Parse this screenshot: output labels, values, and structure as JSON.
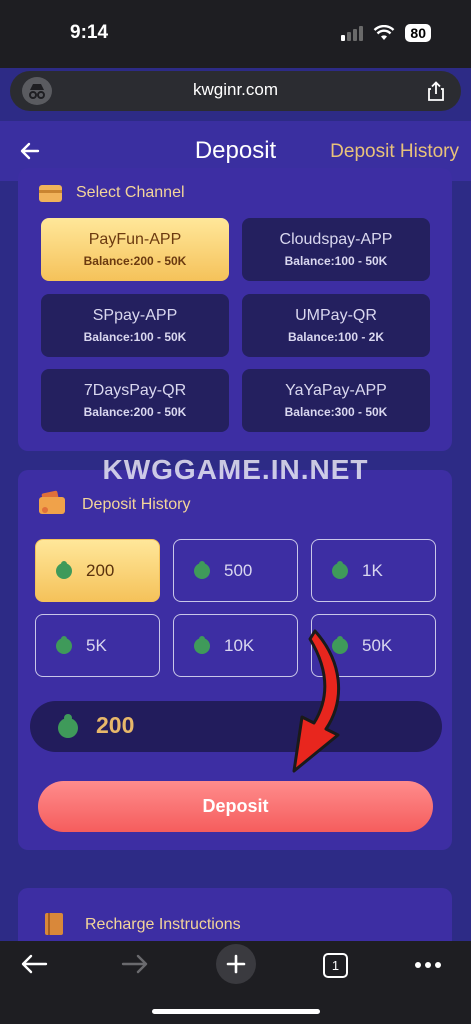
{
  "status": {
    "time": "9:14",
    "battery": "80"
  },
  "browser": {
    "url": "kwginr.com",
    "tab_count": "1"
  },
  "header": {
    "title": "Deposit",
    "history_link": "Deposit History"
  },
  "channel_section": {
    "title": "Select Channel",
    "channels": [
      {
        "name": "PayFun-APP",
        "balance": "Balance:200 - 50K"
      },
      {
        "name": "Cloudspay-APP",
        "balance": "Balance:100 - 50K"
      },
      {
        "name": "SPpay-APP",
        "balance": "Balance:100 - 50K"
      },
      {
        "name": "UMPay-QR",
        "balance": "Balance:100 - 2K"
      },
      {
        "name": "7DaysPay-QR",
        "balance": "Balance:200 - 50K"
      },
      {
        "name": "YaYaPay-APP",
        "balance": "Balance:300 - 50K"
      }
    ],
    "selected": "PayFun-APP"
  },
  "watermark": "KWGGAME.IN.NET",
  "amount_section": {
    "title": "Deposit History",
    "amounts": [
      "200",
      "500",
      "1K",
      "5K",
      "10K",
      "50K"
    ],
    "selected": "200",
    "input_value": "200",
    "submit_label": "Deposit"
  },
  "instructions": {
    "title": "Recharge Instructions"
  },
  "colors": {
    "background": "#2d2b86",
    "card": "#3d2ea3",
    "accent_gold": "#f3d59a",
    "button": "#f55d5d",
    "arrow": "#e8261e"
  }
}
